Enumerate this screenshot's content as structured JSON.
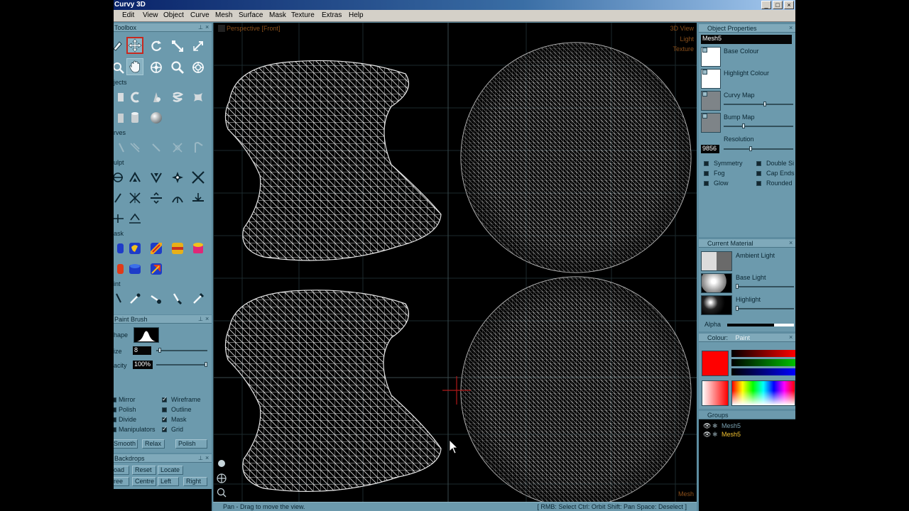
{
  "app": {
    "title": "Curvy 3D"
  },
  "window_buttons": [
    "_",
    "□",
    "×"
  ],
  "menu": [
    "Edit",
    "View",
    "Object",
    "Curve",
    "Mesh",
    "Surface",
    "Mask",
    "Texture",
    "Extras",
    "Help"
  ],
  "toolbox": {
    "header": "Toolbox",
    "sections": {
      "objects": "jects",
      "curves": "rves",
      "sculpt": "ulpt",
      "mask": "ask",
      "paint": "int"
    }
  },
  "paint_brush": {
    "header": "Paint Brush",
    "shape_label": "hape",
    "size_label": "ize",
    "size_value": "8",
    "size_level": 0.05,
    "opacity_label": "acity",
    "opacity_value": "100%",
    "opacity_level": 1.0,
    "options": [
      {
        "label": "Mirror",
        "checked": false
      },
      {
        "label": "Wireframe",
        "checked": true
      },
      {
        "label": "Polish",
        "checked": false
      },
      {
        "label": "Outline",
        "checked": false
      },
      {
        "label": "Divide",
        "checked": false
      },
      {
        "label": "Mask",
        "checked": true
      },
      {
        "label": "Manipulators",
        "checked": false
      },
      {
        "label": "Grid",
        "checked": true
      }
    ],
    "buttons": [
      "Smooth",
      "Relax",
      "Polish"
    ]
  },
  "backdrops": {
    "header": "Backdrops",
    "row1": [
      "oad",
      "Reset",
      "Locate"
    ],
    "row2": [
      "ree",
      "Centre",
      "Left",
      "Right"
    ]
  },
  "viewport": {
    "view_label": "Perspective [Front]",
    "right_labels": [
      "3D View",
      "Light",
      "Texture"
    ],
    "bottom_label": "Mesh",
    "nav_icons": [
      "sphere-nav-icon",
      "pan-nav-icon",
      "zoom-nav-icon"
    ]
  },
  "status": {
    "left": "Pan - Drag to move the view.",
    "right": "[ RMB: Select   Ctrl: Orbit   Shift: Pan   Space: Deselect ]"
  },
  "object_properties": {
    "header": "Object Properties",
    "name": "Mesh5",
    "base_colour": "Base Colour",
    "highlight_colour": "Highlight Colour",
    "curvy_map": "Curvy Map",
    "bump_map": "Bump Map",
    "resolution": "Resolution",
    "resolution_value": "9856",
    "options": [
      {
        "label": "Symmetry",
        "checked": false
      },
      {
        "label": "Double Si",
        "checked": false
      },
      {
        "label": "Fog",
        "checked": false
      },
      {
        "label": "Cap Ends",
        "checked": false
      },
      {
        "label": "Glow",
        "checked": false
      },
      {
        "label": "Rounded",
        "checked": false
      }
    ]
  },
  "current_material": {
    "header": "Current Material",
    "ambient_light": "Ambient Light",
    "base_light": "Base Light",
    "highlight": "Highlight",
    "alpha": "Alpha"
  },
  "colour": {
    "header": "Colour:",
    "mode": "Paint",
    "swatch": "#ff0000"
  },
  "groups": {
    "header": "Groups",
    "items": [
      {
        "name": "Mesh5",
        "active": false
      },
      {
        "name": "Mesh5",
        "active": true
      }
    ]
  }
}
